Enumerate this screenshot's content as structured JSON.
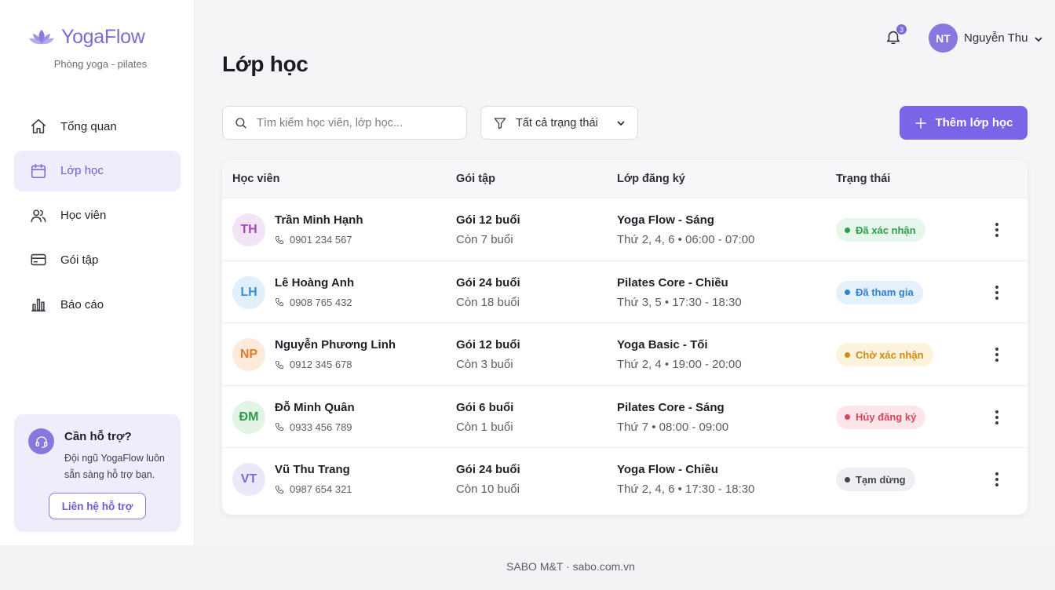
{
  "brand": {
    "name": "YogaFlow",
    "subtitle": "Phòng yoga - pilates"
  },
  "sidebar": {
    "items": [
      {
        "label": "Tổng quan",
        "icon": "home-icon",
        "active": false
      },
      {
        "label": "Lớp học",
        "icon": "calendar-icon",
        "active": true
      },
      {
        "label": "Học viên",
        "icon": "users-icon",
        "active": false
      },
      {
        "label": "Gói tập",
        "icon": "card-icon",
        "active": false
      },
      {
        "label": "Báo cáo",
        "icon": "bar-chart-icon",
        "active": false
      }
    ],
    "support": {
      "title": "Cần hỗ trợ?",
      "description": "Đội ngũ YogaFlow luôn sẵn sàng hỗ trợ bạn.",
      "button": "Liên hệ hỗ trợ"
    }
  },
  "header": {
    "notification_count": "3",
    "user_initials": "NT",
    "user_name": "Nguyễn Thu"
  },
  "page": {
    "title": "Lớp học",
    "search_placeholder": "Tìm kiếm học viên, lớp học...",
    "filter_label": "Tất cả trạng thái",
    "add_button": "Thêm lớp học"
  },
  "table": {
    "columns": [
      "Học viên",
      "Gói tập",
      "Lớp đăng ký",
      "Trạng thái"
    ],
    "rows": [
      {
        "initials": "TH",
        "name": "Trần Minh Hạnh",
        "phone": "0901 234 567",
        "package": "Gói 12 buổi",
        "remaining": "Còn 7 buổi",
        "class": "Yoga Flow - Sáng",
        "schedule": "Thứ 2, 4, 6 • 06:00 - 07:00",
        "status": "Đã xác nhận",
        "avatar_bg": "#f3e3f7",
        "avatar_fg": "#a24bb8",
        "status_bg": "#e6f6ea",
        "status_fg": "#2e9d4b"
      },
      {
        "initials": "LH",
        "name": "Lê Hoàng Anh",
        "phone": "0908 765 432",
        "package": "Gói 24 buổi",
        "remaining": "Còn 18 buổi",
        "class": "Pilates Core - Chiều",
        "schedule": "Thứ 3, 5 • 17:30 - 18:30",
        "status": "Đã tham gia",
        "avatar_bg": "#e1f0fb",
        "avatar_fg": "#3a8fd6",
        "status_bg": "#e4f0fc",
        "status_fg": "#2f7fd4"
      },
      {
        "initials": "NP",
        "name": "Nguyễn Phương Linh",
        "phone": "0912 345 678",
        "package": "Gói 12 buổi",
        "remaining": "Còn 3 buổi",
        "class": "Yoga Basic - Tối",
        "schedule": "Thứ 2, 4 • 19:00 - 20:00",
        "status": "Chờ xác nhận",
        "avatar_bg": "#fdeadb",
        "avatar_fg": "#e07a2c",
        "status_bg": "#fdf3dc",
        "status_fg": "#d18a0c"
      },
      {
        "initials": "ĐM",
        "name": "Đỗ Minh Quân",
        "phone": "0933 456 789",
        "package": "Gói 6 buổi",
        "remaining": "Còn 1 buổi",
        "class": "Pilates Core - Sáng",
        "schedule": "Thứ 7 • 08:00 - 09:00",
        "status": "Hủy đăng ký",
        "avatar_bg": "#e2f4e6",
        "avatar_fg": "#2f9a4f",
        "status_bg": "#fce6ea",
        "status_fg": "#d8435d"
      },
      {
        "initials": "VT",
        "name": "Vũ Thu Trang",
        "phone": "0987 654 321",
        "package": "Gói 24 buổi",
        "remaining": "Còn 10 buổi",
        "class": "Yoga Flow - Chiều",
        "schedule": "Thứ 2, 4, 6 • 17:30 - 18:30",
        "status": "Tạm dừng",
        "avatar_bg": "#ece8fa",
        "avatar_fg": "#7c6ad6",
        "status_bg": "#eeeff2",
        "status_fg": "#44474f"
      }
    ]
  },
  "footer": {
    "text": "SABO M&T · sabo.com.vn"
  }
}
